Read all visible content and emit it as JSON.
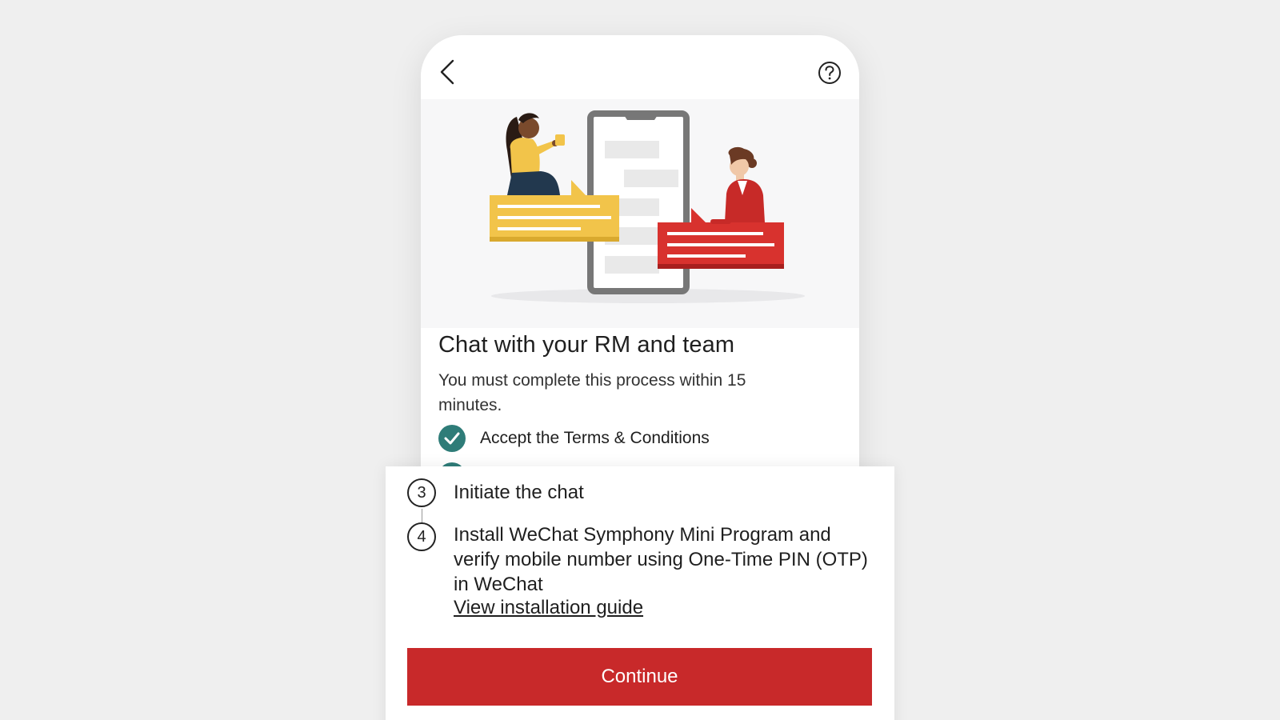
{
  "header": {
    "back_icon": "chevron-left-icon",
    "help_icon": "question-circle-icon"
  },
  "content": {
    "title": "Chat with your RM and team",
    "subtitle": "You must complete this process within 15 minutes.",
    "completed_step": "Accept the Terms & Conditions"
  },
  "sheet": {
    "steps": [
      {
        "number": "3",
        "label": "Initiate the chat"
      },
      {
        "number": "4",
        "label": "Install WeChat Symphony Mini Program and verify mobile number using One-Time PIN (OTP) in WeChat"
      }
    ],
    "guide_link": "View installation guide",
    "continue_label": "Continue"
  },
  "colors": {
    "accent_red": "#c8292a",
    "done_teal": "#2e7c78",
    "background": "#efefef"
  }
}
